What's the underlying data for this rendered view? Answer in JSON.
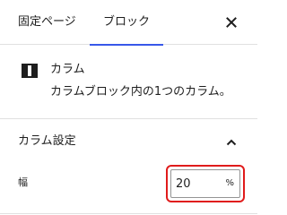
{
  "tabs": {
    "page_label": "固定ページ",
    "block_label": "ブロック",
    "active": "ブロック"
  },
  "close": {
    "icon": "close-icon"
  },
  "block_card": {
    "icon": "columns-icon",
    "title": "カラム",
    "description": "カラムブロック内の1つのカラム。"
  },
  "settings": {
    "title": "カラム設定",
    "expanded": true,
    "width": {
      "label": "幅",
      "value": "20",
      "unit": "%"
    }
  },
  "colors": {
    "accent": "#3858e9",
    "highlight": "#e01b1b",
    "border": "#e0e0e0",
    "text": "#1e1e1e"
  }
}
